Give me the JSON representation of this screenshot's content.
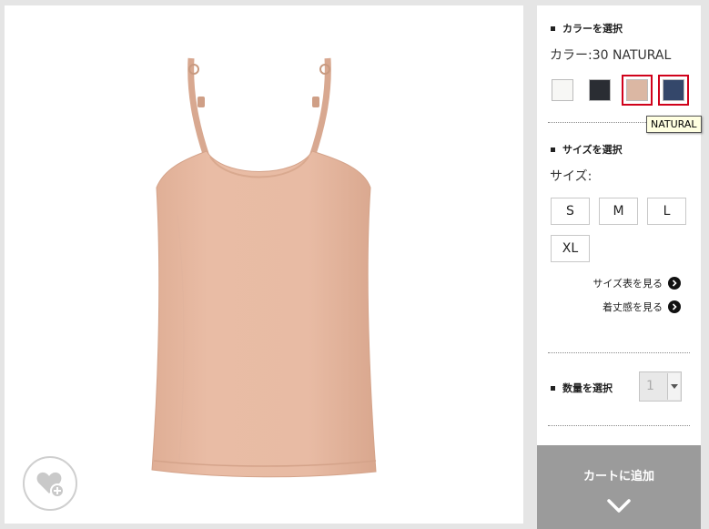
{
  "colors": {
    "title": "カラーを選択",
    "selected_label": "カラー:30 NATURAL",
    "swatches": [
      {
        "name": "white",
        "hex": "#f7f7f5"
      },
      {
        "name": "black",
        "hex": "#2a2d33"
      },
      {
        "name": "natural",
        "hex": "#dbb7a3"
      },
      {
        "name": "navy",
        "hex": "#34476a"
      }
    ],
    "highlighted": [
      "natural",
      "navy"
    ],
    "highlight_color": "#d0021b",
    "tooltip": "NATURAL"
  },
  "size": {
    "title": "サイズを選択",
    "label": "サイズ:",
    "options": [
      "S",
      "M",
      "L",
      "XL"
    ],
    "chart_link": "サイズ表を見る",
    "fit_link": "着丈感を見る"
  },
  "quantity": {
    "title": "数量を選択",
    "value": "1"
  },
  "cart": {
    "label": "カートに追加",
    "icon": "chevron-down-icon"
  },
  "favorite": {
    "icon": "heart-plus-icon"
  },
  "product": {
    "image": "camisole-image",
    "garment_color": "#e7b9a1"
  }
}
